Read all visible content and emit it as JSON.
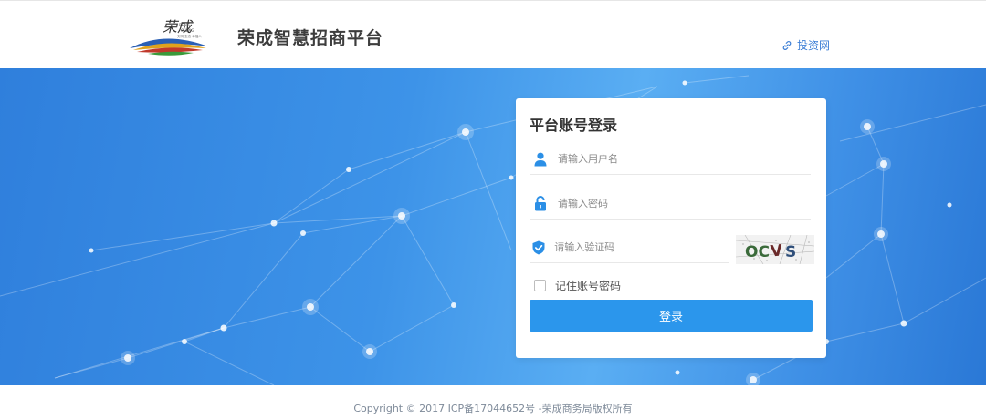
{
  "header": {
    "logo_text": "荣成",
    "logo_subtext": "RONG CHENG",
    "logo_tagline": "文明 · 生态 · 幸福人",
    "site_title": "荣成智慧招商平台",
    "invest_link_label": "投资网",
    "invest_link_icon": "link-icon"
  },
  "login": {
    "title": "平台账号登录",
    "username": {
      "placeholder": "请输入用户名",
      "value": "",
      "icon": "user-icon"
    },
    "password": {
      "placeholder": "请输入密码",
      "value": "",
      "icon": "lock-icon"
    },
    "captcha": {
      "placeholder": "请输入验证码",
      "value": "",
      "icon": "shield-check-icon",
      "image_text": "OCVS"
    },
    "remember_label": "记住账号密码",
    "remember_checked": false,
    "submit_label": "登录"
  },
  "footer": {
    "copyright": "Copyright © 2017 ICP备17044652号 -荣成商务局版权所有"
  },
  "colors": {
    "accent": "#2b96ec",
    "hero_dark": "#2f7fdc",
    "hero_light": "#5aaef3",
    "link": "#3d7fd6"
  }
}
